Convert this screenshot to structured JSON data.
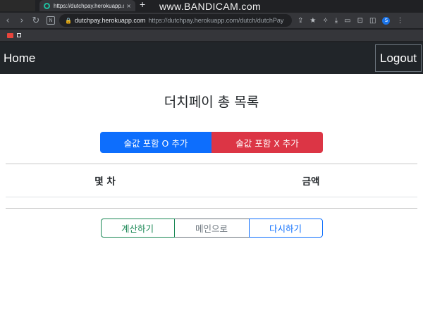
{
  "browser": {
    "tab_title": "https://dutchpay.herokuapp.com",
    "tab_close": "×",
    "new_tab": "+",
    "watermark": "www.BANDICAM.com",
    "url_host": "dutchpay.herokuapp.com",
    "url_path": "https://dutchpay.herokuapp.com/dutch/dutchPay",
    "profile_initial": "S",
    "bookmark_label": ""
  },
  "navbar": {
    "brand": "Home",
    "logout": "Logout"
  },
  "page": {
    "title": "더치페이 총 목록",
    "add_with_alcohol": "술값 포함 O 추가",
    "add_without_alcohol": "술값 포함 X 추가",
    "table": {
      "headers": [
        "몇 차",
        "금액"
      ],
      "rows": []
    },
    "actions": {
      "calculate": "계산하기",
      "to_main": "메인으로",
      "retry": "다시하기"
    }
  },
  "colors": {
    "primary": "#0d6efd",
    "danger": "#dc3545",
    "success": "#198754",
    "secondary": "#6c757d",
    "navbar": "#212529"
  }
}
